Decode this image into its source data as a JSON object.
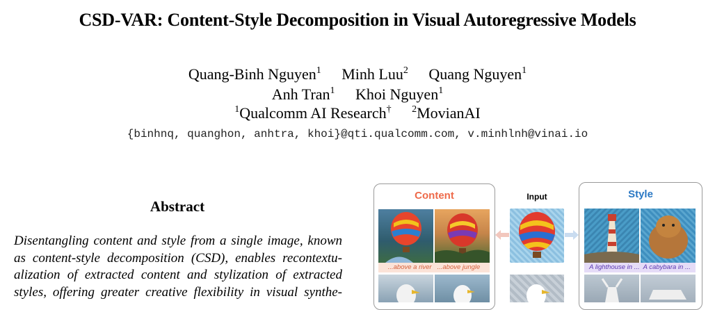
{
  "paper": {
    "title": "CSD-VAR: Content-Style Decomposition in Visual Autoregressive Models",
    "authors_line1": [
      {
        "name": "Quang-Binh Nguyen",
        "sup": "1"
      },
      {
        "name": "Minh Luu",
        "sup": "2"
      },
      {
        "name": "Quang Nguyen",
        "sup": "1"
      }
    ],
    "authors_line2": [
      {
        "name": "Anh Tran",
        "sup": "1"
      },
      {
        "name": "Khoi Nguyen",
        "sup": "1"
      }
    ],
    "affiliations": [
      {
        "sup": "1",
        "name": "Qualcomm AI Research",
        "mark": "†"
      },
      {
        "sup": "2",
        "name": "MovianAI",
        "mark": ""
      }
    ],
    "emails": "{binhnq, quanghon, anhtra, khoi}@qti.qualcomm.com, v.minhlnh@vinai.io"
  },
  "abstract": {
    "heading": "Abstract",
    "lines": [
      "Disentangling content and style from a single image, known",
      "as content-style decomposition (CSD), enables recontextu-",
      "alization of extracted content and stylization of extracted",
      "styles, offering greater creative flexibility in visual synthe-"
    ]
  },
  "figure": {
    "content_label": "Content",
    "input_label": "Input",
    "style_label": "Style",
    "content_captions": [
      "...above a river",
      "...above jungle"
    ],
    "style_captions": [
      "A lighthouse in ...",
      "A cabybara in ..."
    ],
    "colors": {
      "content": "#ee6a4a",
      "style": "#2a78c4"
    }
  }
}
